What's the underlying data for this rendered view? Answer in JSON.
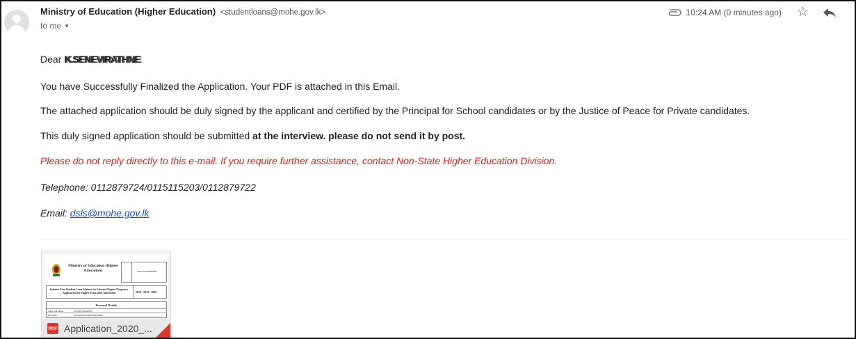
{
  "sender": {
    "name": "Ministry of Education (Higher Education)",
    "email": "<studentloans@mohe.gov.lk>"
  },
  "recipient": {
    "label": "to me"
  },
  "meta": {
    "timestamp": "10:24 AM (0 minutes ago)"
  },
  "icons": [
    "avatar-icon",
    "chevron-down-icon",
    "attachment-icon",
    "star-icon",
    "reply-icon",
    "pdf-icon"
  ],
  "message": {
    "greeting_prefix": "Dear",
    "greeting_name": "K.SENEVIRATHNE",
    "greeting_overlay": "K.SENEVIRATHNE",
    "greeting_suffix": ":",
    "line1": "You have Successfully Finalized the Application. Your PDF is attached in this Email.",
    "line2": "The attached application should be duly signed by the applicant and certified by the Principal for School candidates or by the Justice of Peace for Private candidates.",
    "line3_prefix": "This duly signed application should be submitted ",
    "line3_bold": "at the interview. please do not send it by post.",
    "notice": "Please do not reply directly to this e-mail. If you require further assistance, contact Non-State Higher Education Division.",
    "telephone": "Telephone: 0112879724/0115115203/0112879722",
    "email_label": "Email: ",
    "email_link": "dsls@mohe.gov.lk"
  },
  "colors": {
    "notice": "#e31b1b",
    "link": "#1155cc",
    "pdf": "#db3a2f"
  },
  "attachment": {
    "filename": "Application_2020_...",
    "thumbnail": {
      "title": "Ministry of Education (Higher Education)",
      "code": "2020/2019/0000000",
      "scheme": "Interest Free Student Loan Scheme for Selected Degree Programs Application for Higher Education Admission",
      "years": "2018 / 2019 / 2020",
      "section": "Personal Details",
      "row1_label": "Name with Initials",
      "row1_value": "K.SENEVIRATHNE",
      "row2_label": "Full Name",
      "row2_value": "KAUSHALYA SENEVIRATHNE"
    }
  }
}
